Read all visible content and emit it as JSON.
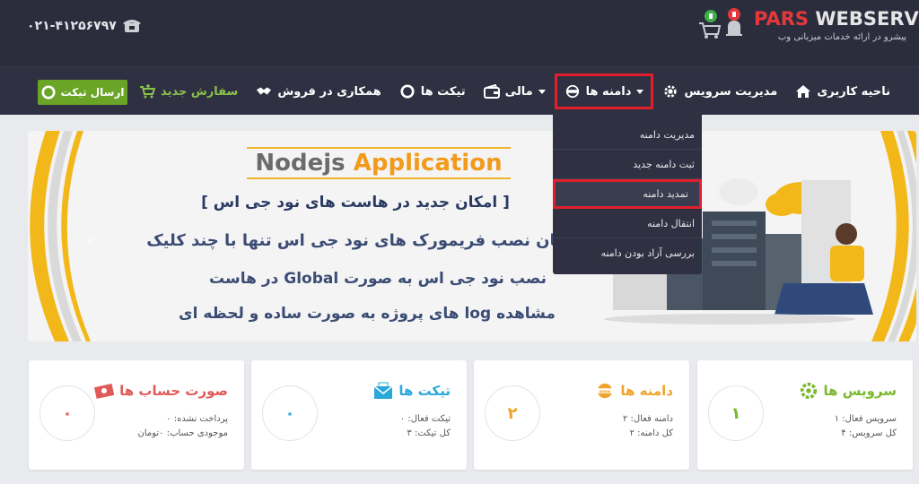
{
  "header": {
    "logo_part1": "PARS",
    "logo_part2": "WEBSERVER",
    "logo_tagline": "پیشرو در ارائه خدمات میزبانی وب",
    "phone": "۰۲۱-۴۱۲۵۶۷۹۷"
  },
  "nav": {
    "items": [
      {
        "label": "ناحیه کاربری",
        "icon": "home-icon"
      },
      {
        "label": "مدیریت سرویس",
        "icon": "gear-icon"
      },
      {
        "label": "دامنه ها",
        "icon": "www-icon"
      },
      {
        "label": "مالی",
        "icon": "wallet-icon"
      },
      {
        "label": "تیکت ها",
        "icon": "lifebuoy-icon"
      },
      {
        "label": "همکاری در فروش",
        "icon": "handshake-icon"
      },
      {
        "label": "سفارش جدید",
        "icon": "cart-plus-icon"
      }
    ],
    "send_ticket": "ارسال تیکت"
  },
  "dropdown": {
    "items": [
      "مدیریت دامنه",
      "ثبت دامنه جدید",
      "تمدید دامنه",
      "انتقال دامنه",
      "بررسی آزاد بودن دامنه"
    ]
  },
  "banner": {
    "title_part1": "Nodejs",
    "title_part2": "Application",
    "line1": "[ امکان جدید در هاست های نود جی اس ]",
    "line2": "امکان نصب فریمورک های نود جی اس تنها با چند کلیک",
    "line3": "نصب نود جی اس به صورت Global در هاست",
    "line4": "مشاهده log های پروژه به صورت ساده و لحظه ای"
  },
  "cards": [
    {
      "title": "سرویس ها",
      "line1": "سرویس فعال: ۱",
      "line2": "کل سرویس: ۴",
      "count": "۱",
      "color": "#7cb82f"
    },
    {
      "title": "دامنه ها",
      "line1": "دامنه فعال: ۲",
      "line2": "کل دامنه: ۲",
      "count": "۲",
      "color": "#f0a42b"
    },
    {
      "title": "تیکت ها",
      "line1": "تیکت فعال: ۰",
      "line2": "کل تیکت: ۳",
      "count": "۰",
      "color": "#2aa8d8"
    },
    {
      "title": "صورت حساب ها",
      "line1": "پرداخت نشده: ۰",
      "line2": "موجودی حساب: ۰تومان",
      "count": "۰",
      "color": "#e05a5a"
    }
  ]
}
